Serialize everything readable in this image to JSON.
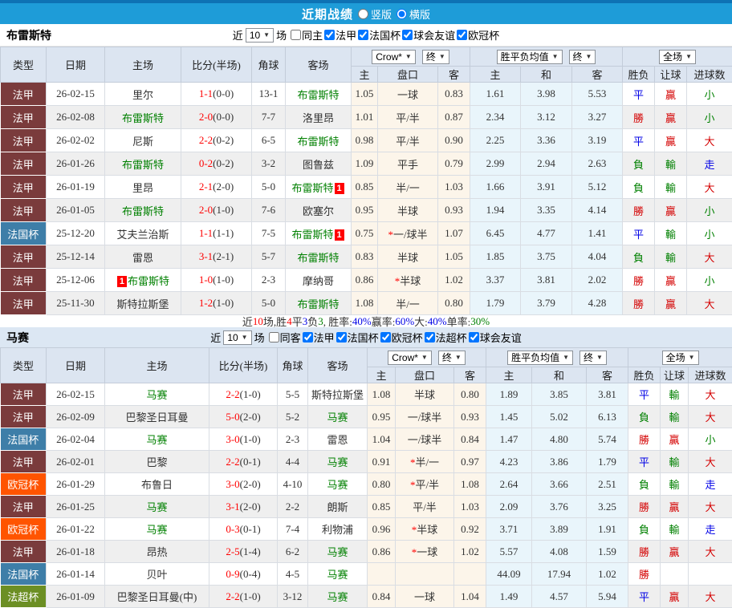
{
  "topbar": {
    "title": "近期战绩",
    "radio_vertical": "竖版",
    "radio_horizontal": "横版",
    "selected": "横版"
  },
  "filters": {
    "near_label": "近",
    "games_label": "场"
  },
  "table_header": {
    "type": "类型",
    "date": "日期",
    "home": "主场",
    "score": "比分(半场)",
    "corner": "角球",
    "away": "客场",
    "book": "Crow*",
    "final": "终",
    "avg": "胜平负均值",
    "scope": "全场",
    "sub_home": "主",
    "sub_handicap": "盘口",
    "sub_away": "客",
    "sub_avg_home": "主",
    "sub_avg_draw": "和",
    "sub_avg_away": "客",
    "sub_wdl": "胜负",
    "sub_let": "让球",
    "sub_goals": "进球数"
  },
  "colors": {
    "league": {
      "法甲": "#7A3B3C",
      "法国杯": "#3E7EA8",
      "欧冠杯": "#FF5400",
      "法超杯": "#6C8F24"
    },
    "result": {
      "勝": "#D40000",
      "負": "#008000",
      "平": "#0000E6",
      "贏": "#D40000",
      "輸": "#008000",
      "走": "#0000E6",
      "大": "#D40000",
      "小": "#008000"
    },
    "self_team": "#008000",
    "score": "#FF0000",
    "topbar": "#1E9CD8"
  },
  "sections": [
    {
      "team": "布雷斯特",
      "filter": {
        "count": "10",
        "checkboxes": [
          {
            "label": "同主",
            "checked": false
          },
          {
            "label": "法甲",
            "checked": true
          },
          {
            "label": "法国杯",
            "checked": true
          },
          {
            "label": "球会友谊",
            "checked": true
          },
          {
            "label": "欧冠杯",
            "checked": true
          }
        ]
      },
      "rows": [
        {
          "league": "法甲",
          "date": "26-02-15",
          "home": {
            "name": "里尔",
            "self": false
          },
          "score": {
            "ft": "1-1",
            "ht": "(0-0)"
          },
          "corners": "13-1",
          "away": {
            "name": "布雷斯特",
            "self": true
          },
          "odds": [
            "1.05",
            "一球",
            "0.83"
          ],
          "avg": [
            "1.61",
            "3.98",
            "5.53"
          ],
          "results": [
            "平",
            "贏",
            "小"
          ]
        },
        {
          "league": "法甲",
          "date": "26-02-08",
          "home": {
            "name": "布雷斯特",
            "self": true
          },
          "score": {
            "ft": "2-0",
            "ht": "(0-0)"
          },
          "corners": "7-7",
          "away": {
            "name": "洛里昂",
            "self": false
          },
          "odds": [
            "1.01",
            "平/半",
            "0.87"
          ],
          "avg": [
            "2.34",
            "3.12",
            "3.27"
          ],
          "results": [
            "勝",
            "贏",
            "小"
          ]
        },
        {
          "league": "法甲",
          "date": "26-02-02",
          "home": {
            "name": "尼斯",
            "self": false
          },
          "score": {
            "ft": "2-2",
            "ht": "(0-2)"
          },
          "corners": "6-5",
          "away": {
            "name": "布雷斯特",
            "self": true
          },
          "odds": [
            "0.98",
            "平/半",
            "0.90"
          ],
          "avg": [
            "2.25",
            "3.36",
            "3.19"
          ],
          "results": [
            "平",
            "贏",
            "大"
          ]
        },
        {
          "league": "法甲",
          "date": "26-01-26",
          "home": {
            "name": "布雷斯特",
            "self": true
          },
          "score": {
            "ft": "0-2",
            "ht": "(0-2)"
          },
          "corners": "3-2",
          "away": {
            "name": "图鲁兹",
            "self": false
          },
          "odds": [
            "1.09",
            "平手",
            "0.79"
          ],
          "avg": [
            "2.99",
            "2.94",
            "2.63"
          ],
          "results": [
            "負",
            "輸",
            "走"
          ]
        },
        {
          "league": "法甲",
          "date": "26-01-19",
          "home": {
            "name": "里昂",
            "self": false
          },
          "score": {
            "ft": "2-1",
            "ht": "(2-0)"
          },
          "corners": "5-0",
          "away": {
            "name": "布雷斯特",
            "self": true,
            "badge": "1",
            "badge_pos": "after"
          },
          "odds": [
            "0.85",
            "半/一",
            "1.03"
          ],
          "avg": [
            "1.66",
            "3.91",
            "5.12"
          ],
          "results": [
            "負",
            "輸",
            "大"
          ]
        },
        {
          "league": "法甲",
          "date": "26-01-05",
          "home": {
            "name": "布雷斯特",
            "self": true
          },
          "score": {
            "ft": "2-0",
            "ht": "(1-0)"
          },
          "corners": "7-6",
          "away": {
            "name": "欧塞尔",
            "self": false
          },
          "odds": [
            "0.95",
            "半球",
            "0.93"
          ],
          "avg": [
            "1.94",
            "3.35",
            "4.14"
          ],
          "results": [
            "勝",
            "贏",
            "小"
          ]
        },
        {
          "league": "法国杯",
          "date": "25-12-20",
          "home": {
            "name": "艾夫兰治斯",
            "self": false
          },
          "score": {
            "ft": "1-1",
            "ht": "(1-1)"
          },
          "corners": "7-5",
          "away": {
            "name": "布雷斯特",
            "self": true,
            "badge": "1",
            "badge_pos": "after"
          },
          "odds": [
            "0.75",
            "*一/球半",
            "1.07"
          ],
          "avg": [
            "6.45",
            "4.77",
            "1.41"
          ],
          "results": [
            "平",
            "輸",
            "小"
          ]
        },
        {
          "league": "法甲",
          "date": "25-12-14",
          "home": {
            "name": "雷恩",
            "self": false
          },
          "score": {
            "ft": "3-1",
            "ht": "(2-1)"
          },
          "corners": "5-7",
          "away": {
            "name": "布雷斯特",
            "self": true
          },
          "odds": [
            "0.83",
            "半球",
            "1.05"
          ],
          "avg": [
            "1.85",
            "3.75",
            "4.04"
          ],
          "results": [
            "負",
            "輸",
            "大"
          ]
        },
        {
          "league": "法甲",
          "date": "25-12-06",
          "home": {
            "name": "布雷斯特",
            "self": true,
            "badge": "1",
            "badge_pos": "before"
          },
          "score": {
            "ft": "1-0",
            "ht": "(1-0)"
          },
          "corners": "2-3",
          "away": {
            "name": "摩纳哥",
            "self": false
          },
          "odds": [
            "0.86",
            "*半球",
            "1.02"
          ],
          "avg": [
            "3.37",
            "3.81",
            "2.02"
          ],
          "results": [
            "勝",
            "贏",
            "小"
          ]
        },
        {
          "league": "法甲",
          "date": "25-11-30",
          "home": {
            "name": "斯特拉斯堡",
            "self": false
          },
          "score": {
            "ft": "1-2",
            "ht": "(1-0)"
          },
          "corners": "5-0",
          "away": {
            "name": "布雷斯特",
            "self": true
          },
          "odds": [
            "1.08",
            "半/一",
            "0.80"
          ],
          "avg": [
            "1.79",
            "3.79",
            "4.28"
          ],
          "results": [
            "勝",
            "贏",
            "大"
          ]
        }
      ],
      "summary_segments": [
        {
          "text": "近",
          "color": "#333333"
        },
        {
          "text": "10",
          "color": "#FF0000"
        },
        {
          "text": "场,胜",
          "color": "#333333"
        },
        {
          "text": "4",
          "color": "#FF0000"
        },
        {
          "text": "平",
          "color": "#333333"
        },
        {
          "text": "3",
          "color": "#0000E6"
        },
        {
          "text": "负",
          "color": "#333333"
        },
        {
          "text": "3",
          "color": "#008000"
        },
        {
          "text": ", 胜率:",
          "color": "#333333"
        },
        {
          "text": "40%",
          "color": "#0000E6"
        },
        {
          "text": " 赢率:",
          "color": "#333333"
        },
        {
          "text": "60%",
          "color": "#0000E6"
        },
        {
          "text": " 大:",
          "color": "#333333"
        },
        {
          "text": "40%",
          "color": "#0000E6"
        },
        {
          "text": " 单率:",
          "color": "#333333"
        },
        {
          "text": "30%",
          "color": "#008000"
        }
      ]
    },
    {
      "team": "马赛",
      "filter": {
        "count": "10",
        "checkboxes": [
          {
            "label": "同客",
            "checked": false
          },
          {
            "label": "法甲",
            "checked": true
          },
          {
            "label": "法国杯",
            "checked": true
          },
          {
            "label": "欧冠杯",
            "checked": true
          },
          {
            "label": "法超杯",
            "checked": true
          },
          {
            "label": "球会友谊",
            "checked": true
          }
        ]
      },
      "rows": [
        {
          "league": "法甲",
          "date": "26-02-15",
          "home": {
            "name": "马赛",
            "self": true
          },
          "score": {
            "ft": "2-2",
            "ht": "(1-0)"
          },
          "corners": "5-5",
          "away": {
            "name": "斯特拉斯堡",
            "self": false
          },
          "odds": [
            "1.08",
            "半球",
            "0.80"
          ],
          "avg": [
            "1.89",
            "3.85",
            "3.81"
          ],
          "results": [
            "平",
            "輸",
            "大"
          ]
        },
        {
          "league": "法甲",
          "date": "26-02-09",
          "home": {
            "name": "巴黎圣日耳曼",
            "self": false
          },
          "score": {
            "ft": "5-0",
            "ht": "(2-0)"
          },
          "corners": "5-2",
          "away": {
            "name": "马赛",
            "self": true
          },
          "odds": [
            "0.95",
            "一/球半",
            "0.93"
          ],
          "avg": [
            "1.45",
            "5.02",
            "6.13"
          ],
          "results": [
            "負",
            "輸",
            "大"
          ]
        },
        {
          "league": "法国杯",
          "date": "26-02-04",
          "home": {
            "name": "马赛",
            "self": true
          },
          "score": {
            "ft": "3-0",
            "ht": "(1-0)"
          },
          "corners": "2-3",
          "away": {
            "name": "雷恩",
            "self": false
          },
          "odds": [
            "1.04",
            "一/球半",
            "0.84"
          ],
          "avg": [
            "1.47",
            "4.80",
            "5.74"
          ],
          "results": [
            "勝",
            "贏",
            "小"
          ]
        },
        {
          "league": "法甲",
          "date": "26-02-01",
          "home": {
            "name": "巴黎",
            "self": false
          },
          "score": {
            "ft": "2-2",
            "ht": "(0-1)"
          },
          "corners": "4-4",
          "away": {
            "name": "马赛",
            "self": true
          },
          "odds": [
            "0.91",
            "*半/一",
            "0.97"
          ],
          "avg": [
            "4.23",
            "3.86",
            "1.79"
          ],
          "results": [
            "平",
            "輸",
            "大"
          ]
        },
        {
          "league": "欧冠杯",
          "date": "26-01-29",
          "home": {
            "name": "布鲁日",
            "self": false
          },
          "score": {
            "ft": "3-0",
            "ht": "(2-0)"
          },
          "corners": "4-10",
          "away": {
            "name": "马赛",
            "self": true
          },
          "odds": [
            "0.80",
            "*平/半",
            "1.08"
          ],
          "avg": [
            "2.64",
            "3.66",
            "2.51"
          ],
          "results": [
            "負",
            "輸",
            "走"
          ]
        },
        {
          "league": "法甲",
          "date": "26-01-25",
          "home": {
            "name": "马赛",
            "self": true
          },
          "score": {
            "ft": "3-1",
            "ht": "(2-0)"
          },
          "corners": "2-2",
          "away": {
            "name": "朗斯",
            "self": false
          },
          "odds": [
            "0.85",
            "平/半",
            "1.03"
          ],
          "avg": [
            "2.09",
            "3.76",
            "3.25"
          ],
          "results": [
            "勝",
            "贏",
            "大"
          ]
        },
        {
          "league": "欧冠杯",
          "date": "26-01-22",
          "home": {
            "name": "马赛",
            "self": true
          },
          "score": {
            "ft": "0-3",
            "ht": "(0-1)"
          },
          "corners": "7-4",
          "away": {
            "name": "利物浦",
            "self": false
          },
          "odds": [
            "0.96",
            "*半球",
            "0.92"
          ],
          "avg": [
            "3.71",
            "3.89",
            "1.91"
          ],
          "results": [
            "負",
            "輸",
            "走"
          ]
        },
        {
          "league": "法甲",
          "date": "26-01-18",
          "home": {
            "name": "昂热",
            "self": false
          },
          "score": {
            "ft": "2-5",
            "ht": "(1-4)"
          },
          "corners": "6-2",
          "away": {
            "name": "马赛",
            "self": true
          },
          "odds": [
            "0.86",
            "*一球",
            "1.02"
          ],
          "avg": [
            "5.57",
            "4.08",
            "1.59"
          ],
          "results": [
            "勝",
            "贏",
            "大"
          ]
        },
        {
          "league": "法国杯",
          "date": "26-01-14",
          "home": {
            "name": "贝叶",
            "self": false
          },
          "score": {
            "ft": "0-9",
            "ht": "(0-4)"
          },
          "corners": "4-5",
          "away": {
            "name": "马赛",
            "self": true
          },
          "odds": [
            "",
            "",
            ""
          ],
          "avg": [
            "44.09",
            "17.94",
            "1.02"
          ],
          "results": [
            "勝",
            "",
            ""
          ]
        },
        {
          "league": "法超杯",
          "date": "26-01-09",
          "home": {
            "name": "巴黎圣日耳曼(中)",
            "self": false
          },
          "score": {
            "ft": "2-2",
            "ht": "(1-0)"
          },
          "corners": "3-12",
          "away": {
            "name": "马赛",
            "self": true
          },
          "odds": [
            "0.84",
            "一球",
            "1.04"
          ],
          "avg": [
            "1.49",
            "4.57",
            "5.94"
          ],
          "results": [
            "平",
            "贏",
            "大"
          ]
        }
      ]
    }
  ]
}
